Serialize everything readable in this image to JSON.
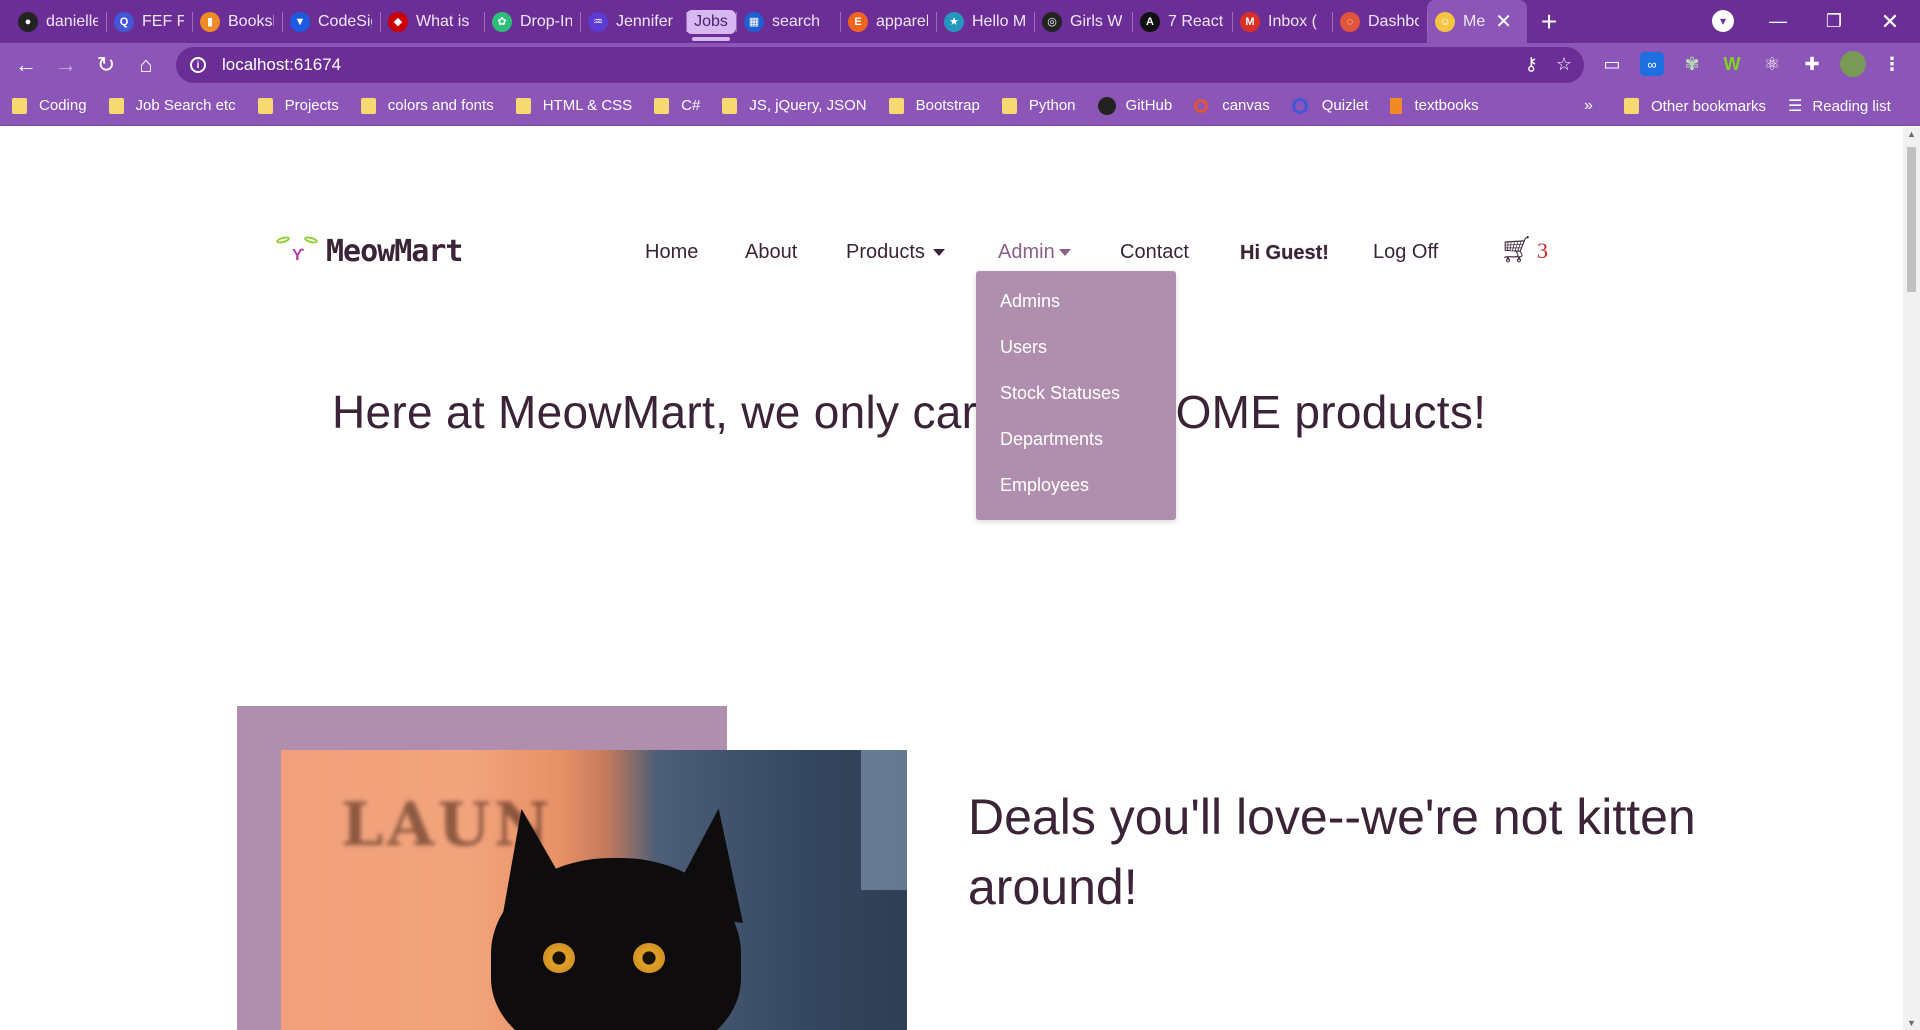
{
  "browser": {
    "tabs": [
      {
        "title": "danielle",
        "icon": "github-icon",
        "color": "#222222"
      },
      {
        "title": "FEF Flas",
        "icon": "quizlet-icon",
        "color": "#4256d6"
      },
      {
        "title": "Booksh",
        "icon": "bookmark-icon",
        "color": "#f08a24"
      },
      {
        "title": "CodeSig",
        "icon": "codesignal-icon",
        "color": "#1e5ae0"
      },
      {
        "title": "What is",
        "icon": "redhat-icon",
        "color": "#cc0000"
      },
      {
        "title": "Drop-In",
        "icon": "paw-icon",
        "color": "#2dbf7a"
      },
      {
        "title": "Jennifer",
        "icon": "chart-icon",
        "color": "#5b3bd1"
      },
      {
        "title": "Jobs",
        "icon": "",
        "color": "#d8b8f0"
      },
      {
        "title": "search",
        "icon": "dice-icon",
        "color": "#1f5fd0"
      },
      {
        "title": "apparel",
        "icon": "etsy-icon",
        "color": "#f1641e"
      },
      {
        "title": "Hello M",
        "icon": "star-icon",
        "color": "#2596be"
      },
      {
        "title": "Girls W",
        "icon": "girlswhocode-icon",
        "color": "#222222"
      },
      {
        "title": "7 React",
        "icon": "react-a-icon",
        "color": "#111111"
      },
      {
        "title": "Inbox (",
        "icon": "gmail-icon",
        "color": "#d93025"
      },
      {
        "title": "Dashbo",
        "icon": "canvas-icon",
        "color": "#e0553a"
      },
      {
        "title": "Me",
        "icon": "cat-face-icon",
        "color": "#f4c542"
      }
    ],
    "tab_glyphs": [
      "●",
      "Q",
      "▮",
      "▼",
      "◆",
      "✿",
      "♒",
      "",
      "▦",
      "E",
      "★",
      "◎",
      "A",
      "M",
      "◌",
      "☺"
    ],
    "new_tab_label": "+",
    "url": "localhost:61674",
    "bookmarks": [
      {
        "label": "Coding",
        "kind": "folder"
      },
      {
        "label": "Job Search etc",
        "kind": "folder"
      },
      {
        "label": "Projects",
        "kind": "folder"
      },
      {
        "label": "colors and fonts",
        "kind": "folder"
      },
      {
        "label": "HTML & CSS",
        "kind": "folder"
      },
      {
        "label": "C#",
        "kind": "folder"
      },
      {
        "label": "JS, jQuery, JSON",
        "kind": "folder"
      },
      {
        "label": "Bootstrap",
        "kind": "folder"
      },
      {
        "label": "Python",
        "kind": "folder"
      },
      {
        "label": "GitHub",
        "kind": "github"
      },
      {
        "label": "canvas",
        "kind": "canvas"
      },
      {
        "label": "Quizlet",
        "kind": "quizlet"
      },
      {
        "label": "textbooks",
        "kind": "textbook"
      }
    ],
    "bookmarks_overflow": "»",
    "other_bookmarks": "Other bookmarks",
    "reading_list": "Reading list"
  },
  "site": {
    "brand": "MeowMart",
    "nav": {
      "home": "Home",
      "about": "About",
      "products": "Products",
      "admin": "Admin",
      "contact": "Contact",
      "greeting": "Hi Guest!",
      "logoff": "Log Off",
      "cart_count": "3"
    },
    "admin_menu": [
      "Admins",
      "Users",
      "Stock Statuses",
      "Departments",
      "Employees"
    ],
    "hero_title": "Here at MeowMart, we only carry PAW-SOME products!",
    "photo_text": "LAUN",
    "deals_heading": "Deals you'll love--we're not kitten around!"
  },
  "colors": {
    "chrome_dark": "#6a2e96",
    "chrome_light": "#8c55b8",
    "brand_mauve": "#b08fae",
    "text_dark": "#3b2437",
    "cart_count": "#c8262a"
  }
}
